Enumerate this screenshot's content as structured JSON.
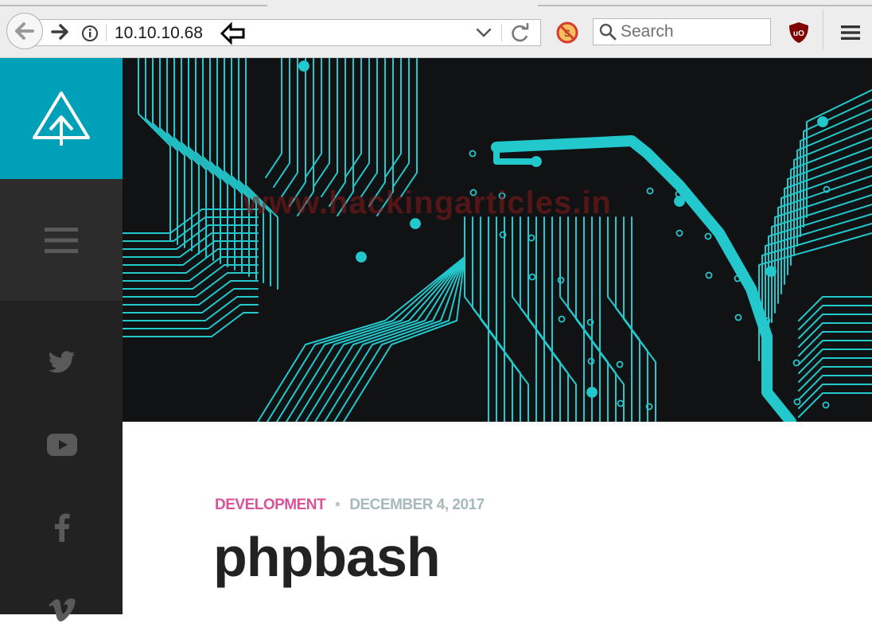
{
  "browser": {
    "url": "10.10.10.68",
    "search_placeholder": "Search",
    "icons": [
      "back-arrow-icon",
      "forward-arrow-icon",
      "info-icon",
      "annotation-arrow-icon",
      "dropdown-chevron-icon",
      "reload-icon",
      "noscript-icon",
      "search-icon",
      "ublock-origin-icon",
      "hamburger-menu-icon"
    ]
  },
  "site": {
    "sidebar": {
      "logo_icon": "triangle-arrow-logo-icon",
      "menu_icon": "hamburger-icon",
      "social_icons": [
        "twitter-icon",
        "youtube-icon",
        "facebook-icon",
        "vimeo-icon"
      ]
    },
    "hero": {
      "watermark": "www.hackingarticles.in"
    },
    "post": {
      "category": "DEVELOPMENT",
      "separator": "•",
      "date": "DECEMBER 4, 2017",
      "title": "phpbash"
    }
  },
  "colors": {
    "accent_teal": "#00a0b8",
    "circuit_cyan": "#22c8cc",
    "category_pink": "#d9529a",
    "date_gray": "#a7b9bb",
    "sidebar_dark": "#222222"
  }
}
